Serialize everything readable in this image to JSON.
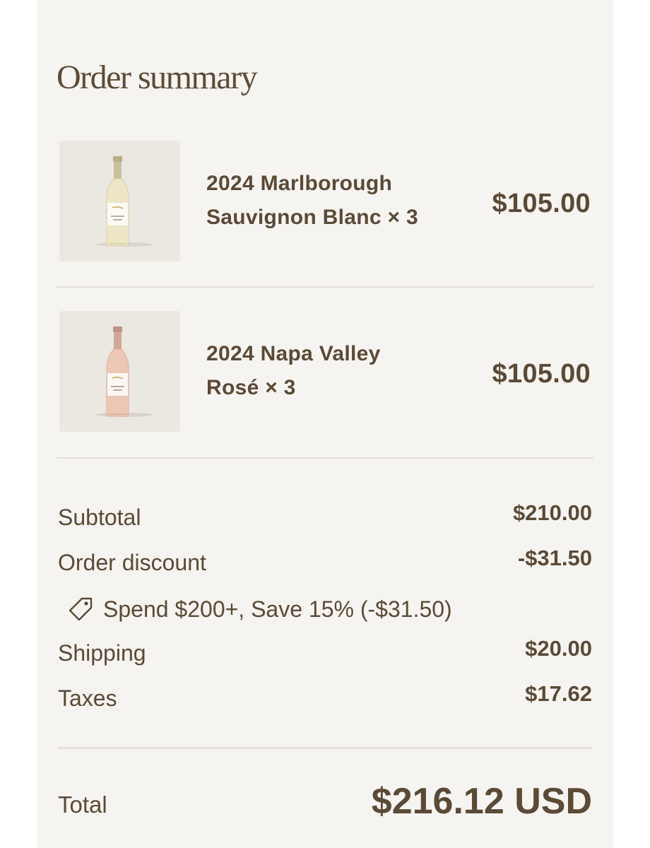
{
  "title": "Order summary",
  "items": [
    {
      "name_line1": "2024 Marlborough",
      "name_line2": "Sauvignon Blanc × 3",
      "price": "$105.00",
      "thumbnail_icon": "white-wine-bottle-icon",
      "bottle_color": "#ece6c6"
    },
    {
      "name_line1": "2024 Napa Valley",
      "name_line2": "Rosé × 3",
      "price": "$105.00",
      "thumbnail_icon": "rose-wine-bottle-icon",
      "bottle_color": "#edc7b6"
    }
  ],
  "summary": {
    "subtotal_label": "Subtotal",
    "subtotal_value": "$210.00",
    "discount_label": "Order discount",
    "discount_value": "-$31.50",
    "discount_note": "Spend $200+, Save 15% (-$31.50)",
    "discount_icon": "tag-icon",
    "shipping_label": "Shipping",
    "shipping_value": "$20.00",
    "taxes_label": "Taxes",
    "taxes_value": "$17.62"
  },
  "total": {
    "label": "Total",
    "value": "$216.12 USD"
  },
  "colors": {
    "text": "#5a4a36",
    "panel": "#f6f4f1",
    "thumb_bg": "#ebe7e1",
    "divider": "#e4e0da"
  }
}
